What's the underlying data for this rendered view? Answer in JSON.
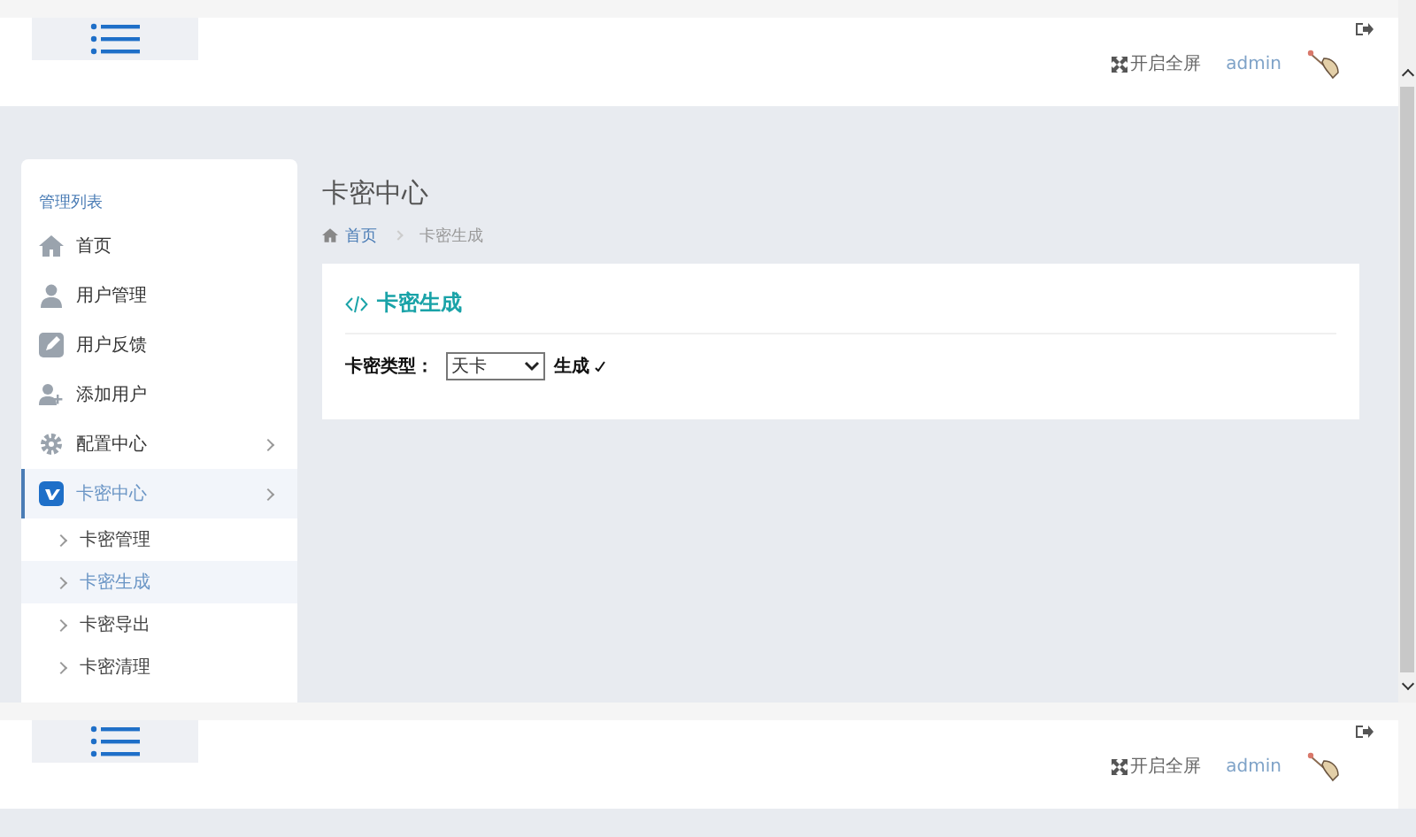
{
  "headers": [
    {
      "fullscreen_label": "开启全屏",
      "user_name": "admin"
    },
    {
      "fullscreen_label": "开启全屏",
      "user_name": "admin"
    }
  ],
  "sidebar": {
    "title": "管理列表",
    "items": [
      {
        "label": "首页",
        "selected": false,
        "kind": "link"
      },
      {
        "label": "用户管理",
        "selected": false,
        "kind": "link"
      },
      {
        "label": "用户反馈",
        "selected": false,
        "kind": "link"
      },
      {
        "label": "添加用户",
        "selected": false,
        "kind": "link"
      },
      {
        "label": "配置中心",
        "selected": false,
        "kind": "group"
      },
      {
        "label": "卡密中心",
        "selected": true,
        "kind": "group",
        "children": [
          {
            "label": "卡密管理",
            "selected": false
          },
          {
            "label": "卡密生成",
            "selected": true
          },
          {
            "label": "卡密导出",
            "selected": false
          },
          {
            "label": "卡密清理",
            "selected": false
          }
        ]
      }
    ]
  },
  "page_title": "卡密中心",
  "breadcrumb": [
    {
      "label": "首页",
      "kind": "link"
    },
    {
      "label": "卡密生成",
      "kind": "current"
    }
  ],
  "card": {
    "title": "卡密生成",
    "field_label": "卡密类型：",
    "select_value": "天卡",
    "submit_label": "生成"
  }
}
